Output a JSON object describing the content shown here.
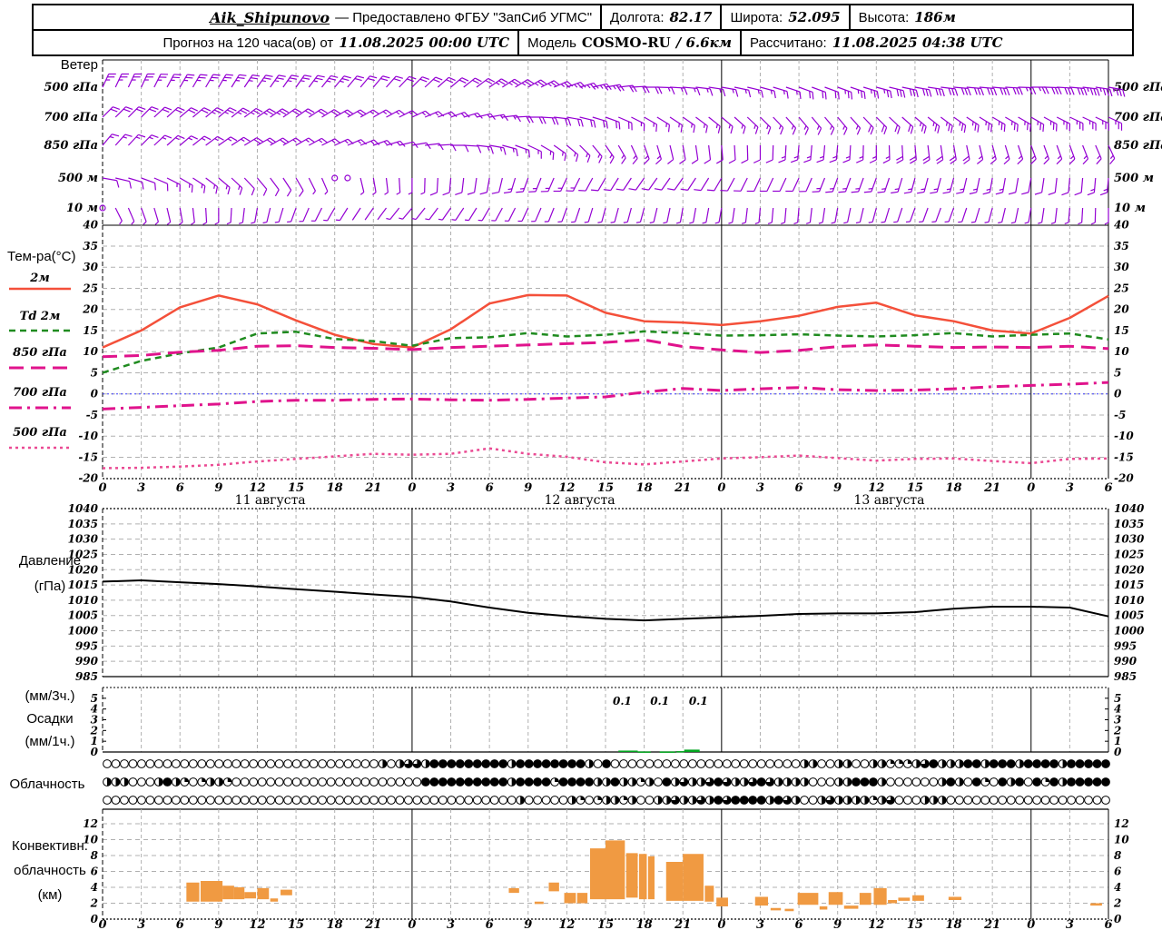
{
  "header": {
    "row1": {
      "station": "Aik_Shipunovo",
      "provider": "— Предоставлено ФГБУ \"ЗапСиб УГМС\"",
      "lon_label": "Долгота:",
      "lon_value": "82.17",
      "lat_label": "Широта:",
      "lat_value": "52.095",
      "alt_label": "Высота:",
      "alt_value": "186м"
    },
    "row2": {
      "forecast_label": "Прогноз на 120 часа(ов) от",
      "forecast_time": "11.08.2025 00:00 UTC",
      "model_label": "Модель",
      "model_name": "COSMO-RU",
      "model_res": "/ 6.6км",
      "calc_label": "Рассчитано:",
      "calc_time": "11.08.2025 04:38 UTC"
    }
  },
  "axis": {
    "hours_total": 78,
    "tick_step": 3,
    "day_starts": [
      0,
      24,
      48
    ],
    "day_labels": [
      "11 августа",
      "12 августа",
      "13 августа"
    ]
  },
  "colors": {
    "barb": "#9400d3",
    "t2m": "#f4503a",
    "td2m": "#1f8b1f",
    "t850": "#e0138c",
    "t700": "#e0138c",
    "t500": "#ea4a93",
    "zero_line": "#3c3cff",
    "pressure": "#000000",
    "precip": "#00a51e",
    "conv": "#f09a42",
    "grid": "#b0b0b0"
  },
  "chart_data": [
    {
      "id": "wind",
      "type": "wind-barbs",
      "title": "Ветер",
      "levels": [
        {
          "label": "500 гПа",
          "dirs": [
            25,
            25,
            30,
            30,
            35,
            35,
            40,
            40,
            45,
            50,
            55,
            60,
            70,
            80,
            90,
            95,
            100,
            105,
            110,
            110,
            105,
            100,
            95,
            95,
            90,
            95,
            100
          ],
          "speeds": [
            12,
            13,
            13,
            14,
            14,
            13,
            12,
            10,
            10,
            10,
            12,
            13,
            13,
            12,
            10,
            8,
            8,
            8,
            10,
            12,
            14,
            16,
            16,
            15,
            14,
            16,
            18
          ],
          "calm": []
        },
        {
          "label": "700 гПа",
          "dirs": [
            45,
            45,
            50,
            50,
            55,
            55,
            60,
            60,
            65,
            70,
            80,
            90,
            100,
            110,
            120,
            125,
            130,
            135,
            140,
            140,
            135,
            130,
            125,
            120,
            120,
            115,
            115
          ],
          "speeds": [
            10,
            10,
            11,
            12,
            12,
            11,
            10,
            9,
            8,
            8,
            9,
            10,
            10,
            10,
            9,
            8,
            7,
            7,
            8,
            9,
            10,
            12,
            13,
            13,
            12,
            12,
            13
          ],
          "calm": []
        },
        {
          "label": "850 гПа",
          "dirs": [
            40,
            45,
            50,
            55,
            60,
            60,
            65,
            70,
            80,
            90,
            100,
            115,
            130,
            145,
            160,
            170,
            175,
            180,
            185,
            185,
            180,
            175,
            170,
            165,
            160,
            160,
            155
          ],
          "speeds": [
            8,
            8,
            9,
            9,
            10,
            9,
            8,
            7,
            6,
            6,
            7,
            8,
            8,
            8,
            7,
            6,
            6,
            6,
            7,
            8,
            9,
            10,
            10,
            9,
            8,
            8,
            9
          ],
          "calm": []
        },
        {
          "label": "500 м",
          "dirs": [
            100,
            110,
            120,
            130,
            140,
            150,
            160,
            170,
            180,
            185,
            190,
            200,
            205,
            210,
            215,
            215,
            210,
            205,
            205,
            200,
            200,
            195,
            195,
            190,
            190,
            185,
            185
          ],
          "speeds": [
            6,
            6,
            7,
            7,
            6,
            5,
            0.5,
            2,
            4,
            5,
            6,
            7,
            7,
            6,
            6,
            5,
            5,
            5,
            6,
            7,
            7,
            8,
            8,
            7,
            6,
            6,
            7
          ],
          "calm": [
            18,
            19
          ]
        },
        {
          "label": "10 м",
          "dirs": [
            150,
            160,
            170,
            180,
            190,
            200,
            210,
            215,
            220,
            215,
            210,
            205,
            200,
            195,
            195,
            190,
            190,
            185,
            185,
            190,
            195,
            200,
            200,
            195,
            190,
            185,
            180
          ],
          "speeds": [
            1,
            3,
            4,
            4,
            4,
            3,
            2,
            1,
            2,
            3,
            4,
            4,
            4,
            3,
            2,
            2,
            3,
            3,
            4,
            4,
            4,
            4,
            4,
            3,
            3,
            4,
            4
          ],
          "calm": [
            0
          ]
        }
      ]
    },
    {
      "id": "temp",
      "type": "line",
      "title": "Тем-ра(°C)",
      "ylim": [
        -20,
        40
      ],
      "ytick": 5,
      "x": [
        0,
        3,
        6,
        9,
        12,
        15,
        18,
        21,
        24,
        27,
        30,
        33,
        36,
        39,
        42,
        45,
        48,
        51,
        54,
        57,
        60,
        63,
        66,
        69,
        72,
        75,
        78
      ],
      "series": [
        {
          "name": "2м",
          "style": "solid",
          "color": "#f4503a",
          "values": [
            11,
            15,
            20.5,
            23.3,
            21.2,
            17.4,
            14,
            11.8,
            11,
            15.3,
            21.4,
            23.4,
            23.3,
            19.2,
            17.2,
            16.9,
            16.3,
            17.2,
            18.5,
            20.6,
            21.6,
            18.6,
            17.2,
            15,
            14.3,
            18,
            23.2
          ]
        },
        {
          "name": "Td  2м",
          "style": "dashed",
          "color": "#1f8b1f",
          "values": [
            5,
            7.8,
            9.6,
            11,
            14.3,
            14.7,
            13,
            12.5,
            11.4,
            13.2,
            13.4,
            14.4,
            13.6,
            14,
            14.8,
            14.4,
            13.8,
            13.9,
            14.1,
            13.8,
            13.6,
            13.9,
            14.4,
            13.6,
            14,
            14.3,
            12.9
          ]
        },
        {
          "name": "850 гПа",
          "style": "longdash",
          "color": "#e0138c",
          "values": [
            8.8,
            9.1,
            9.9,
            10.3,
            11.3,
            11.4,
            11,
            10.8,
            10.5,
            11,
            11.3,
            11.6,
            11.9,
            12.2,
            12.8,
            11.2,
            10.4,
            9.8,
            10.3,
            11.2,
            11.6,
            11.3,
            11,
            11.1,
            11,
            11.3,
            10.7
          ]
        },
        {
          "name": "700 гПа",
          "style": "dashdot",
          "color": "#e0138c",
          "values": [
            -3.6,
            -3.2,
            -2.8,
            -2.4,
            -1.8,
            -1.5,
            -1.5,
            -1.3,
            -1.2,
            -1.4,
            -1.5,
            -1.3,
            -1,
            -0.7,
            0.4,
            1.3,
            0.8,
            1.2,
            1.5,
            1,
            0.8,
            0.9,
            1.2,
            1.7,
            2,
            2.3,
            2.7
          ]
        },
        {
          "name": "500 гПа",
          "style": "dotted",
          "color": "#ea4a93",
          "values": [
            -17.6,
            -17.5,
            -17.2,
            -16.8,
            -16,
            -15.4,
            -14.8,
            -14.2,
            -14.4,
            -14.2,
            -12.9,
            -14.2,
            -14.9,
            -16.2,
            -16.7,
            -16,
            -15.3,
            -15,
            -14.6,
            -15.2,
            -15.8,
            -15.4,
            -15.3,
            -15.9,
            -16.4,
            -15.4,
            -15.3
          ]
        }
      ]
    },
    {
      "id": "pressure",
      "type": "line",
      "title": "Давление",
      "subtitle": "(гПа)",
      "ylim": [
        985,
        1040
      ],
      "ytick": 5,
      "x": [
        0,
        3,
        6,
        9,
        12,
        15,
        18,
        21,
        24,
        27,
        30,
        33,
        36,
        39,
        42,
        45,
        48,
        51,
        54,
        57,
        60,
        63,
        66,
        69,
        72,
        75,
        78
      ],
      "values": [
        1016.1,
        1016.5,
        1015.9,
        1015.3,
        1014.5,
        1013.6,
        1012.8,
        1011.9,
        1011.1,
        1009.6,
        1007.6,
        1005.9,
        1004.8,
        1003.9,
        1003.4,
        1003.9,
        1004.4,
        1004.9,
        1005.5,
        1005.7,
        1005.7,
        1006.1,
        1007.2,
        1007.9,
        1007.9,
        1007.6,
        1004.7
      ]
    },
    {
      "id": "precip",
      "type": "bar",
      "title_lines": [
        "(мм/3ч.)",
        "Осадки",
        "(мм/1ч.)"
      ],
      "ylim": [
        0,
        6
      ],
      "yticks": [
        0,
        1,
        2,
        3,
        4,
        5
      ],
      "bars": [
        [
          40.0,
          41.5,
          0.13
        ],
        [
          41.5,
          42.5,
          0.05
        ],
        [
          43.2,
          44.4,
          0.05
        ],
        [
          44.5,
          45.1,
          0.08
        ],
        [
          45.1,
          46.3,
          0.22
        ]
      ],
      "value_labels": [
        {
          "h": 40.3,
          "text": "0.1"
        },
        {
          "h": 43.2,
          "text": "0.1"
        },
        {
          "h": 46.2,
          "text": "0.1"
        }
      ]
    },
    {
      "id": "cloud",
      "type": "cloud-cover",
      "title": "Облачность",
      "rows": [
        "000000000000000000000000000000002023324444444442444444442040000000000000000000000220022002211123422244244424444244444",
        "222000242101221000000000000000000000044444444442444414444224221204232234322343222200022444200000024204104240414244444",
        "000000000000000000000000000000000000000000000000200000210122120022322324344442432002322221230002220000000000000000000"
      ]
    },
    {
      "id": "conv",
      "type": "range-bar",
      "title_lines": [
        "Конвективн.",
        "облачность",
        "(км)"
      ],
      "ylim": [
        0,
        12
      ],
      "ytick": 2,
      "bars": [
        [
          6.5,
          7.5,
          2.2,
          4.6
        ],
        [
          7.6,
          9.3,
          2.2,
          4.8
        ],
        [
          9.3,
          10.2,
          2.5,
          4.2
        ],
        [
          10.2,
          11.0,
          2.5,
          4.0
        ],
        [
          11.0,
          11.9,
          2.6,
          3.4
        ],
        [
          12.0,
          12.9,
          2.5,
          3.9
        ],
        [
          13.0,
          13.6,
          2.2,
          2.6
        ],
        [
          13.8,
          14.7,
          3.0,
          3.7
        ],
        [
          31.5,
          32.3,
          3.3,
          3.9
        ],
        [
          33.5,
          34.2,
          1.9,
          2.2
        ],
        [
          34.6,
          35.4,
          3.5,
          4.6
        ],
        [
          35.8,
          36.7,
          2.0,
          3.3
        ],
        [
          36.8,
          37.6,
          2.0,
          3.3
        ],
        [
          37.8,
          39.0,
          2.5,
          8.9
        ],
        [
          39.0,
          40.5,
          2.5,
          9.9
        ],
        [
          40.6,
          41.5,
          2.7,
          8.3
        ],
        [
          41.6,
          42.2,
          2.5,
          8.2
        ],
        [
          42.3,
          42.8,
          2.5,
          7.9
        ],
        [
          43.7,
          45.0,
          2.3,
          7.2
        ],
        [
          45.0,
          46.6,
          2.3,
          8.2
        ],
        [
          46.7,
          47.4,
          2.2,
          4.2
        ],
        [
          47.6,
          48.5,
          1.6,
          2.7
        ],
        [
          50.6,
          51.6,
          1.7,
          2.8
        ],
        [
          51.8,
          52.6,
          1.1,
          1.4
        ],
        [
          52.9,
          53.6,
          1.0,
          1.3
        ],
        [
          53.9,
          55.5,
          1.8,
          3.3
        ],
        [
          55.6,
          56.2,
          1.2,
          1.6
        ],
        [
          56.3,
          57.4,
          1.8,
          3.4
        ],
        [
          57.5,
          58.6,
          1.3,
          1.7
        ],
        [
          58.7,
          59.6,
          1.8,
          3.3
        ],
        [
          59.8,
          60.8,
          1.8,
          3.9
        ],
        [
          60.9,
          61.6,
          2.0,
          2.4
        ],
        [
          61.7,
          62.6,
          2.3,
          2.7
        ],
        [
          62.8,
          63.7,
          2.3,
          3.0
        ],
        [
          65.6,
          66.6,
          2.4,
          2.8
        ],
        [
          76.6,
          77.5,
          1.7,
          2.0
        ]
      ]
    }
  ]
}
